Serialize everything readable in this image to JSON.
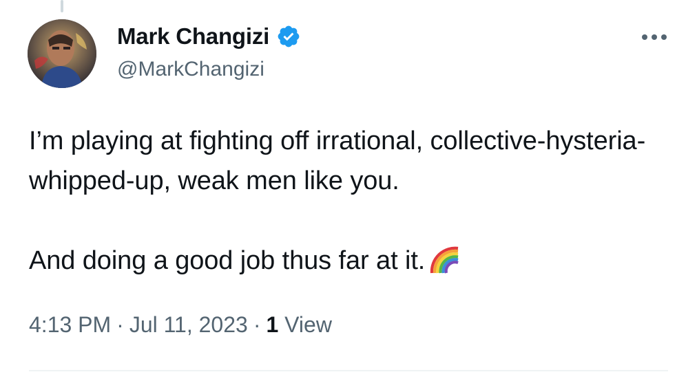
{
  "tweet": {
    "author": {
      "display_name": "Mark Changizi",
      "handle": "@MarkChangizi",
      "verified_icon": "verified-badge-icon",
      "verified_color": "#1d9bf0"
    },
    "text": {
      "paragraph_1": "I’m playing at fighting off irrational, collective-hysteria-whipped-up, weak men like you.",
      "paragraph_2": "And doing a good job thus far at it.",
      "emoji": "rainbow-icon"
    },
    "meta": {
      "time": "4:13 PM",
      "separator": "·",
      "date": "Jul 11, 2023",
      "views_count": "1",
      "views_label": "View"
    },
    "more_icon": "more-options-icon"
  },
  "colors": {
    "text_primary": "#0f1419",
    "text_secondary": "#536471",
    "divider": "#eff3f4"
  }
}
